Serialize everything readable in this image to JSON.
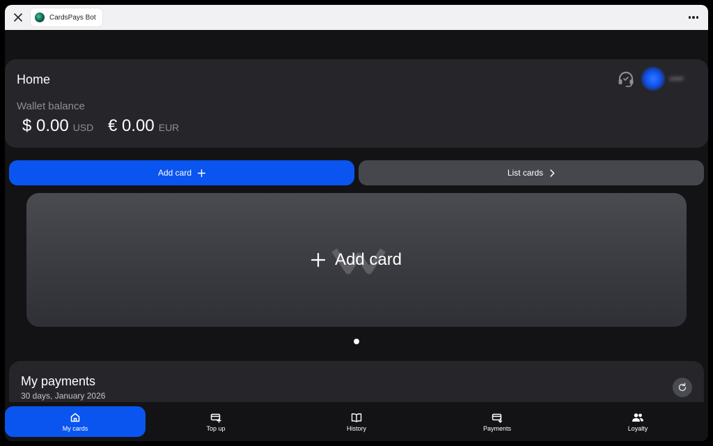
{
  "topbar": {
    "bot_title": "CardsPays Bot",
    "close_icon": "close-icon",
    "more_icon": "more-horizontal-icon"
  },
  "home": {
    "title": "Home",
    "user_name": "user",
    "wallet_label": "Wallet balance",
    "balances": [
      {
        "amount": "$ 0.00",
        "currency": "USD"
      },
      {
        "amount": "€ 0.00",
        "currency": "EUR"
      }
    ]
  },
  "actions": {
    "add_card_label": "Add card",
    "list_cards_label": "List cards"
  },
  "card_slot": {
    "label": "Add card"
  },
  "payments": {
    "title": "My payments",
    "subtitle": "30 days, January 2026"
  },
  "nav": {
    "items": [
      {
        "label": "My cards",
        "icon": "home-icon"
      },
      {
        "label": "Top up",
        "icon": "card-topup-icon"
      },
      {
        "label": "History",
        "icon": "book-icon"
      },
      {
        "label": "Payments",
        "icon": "card-payment-icon"
      },
      {
        "label": "Loyalty",
        "icon": "users-icon"
      }
    ]
  },
  "colors": {
    "accent": "#0a55f0",
    "background": "#131316",
    "card": "#25252a",
    "secondary_button": "#46474d"
  }
}
